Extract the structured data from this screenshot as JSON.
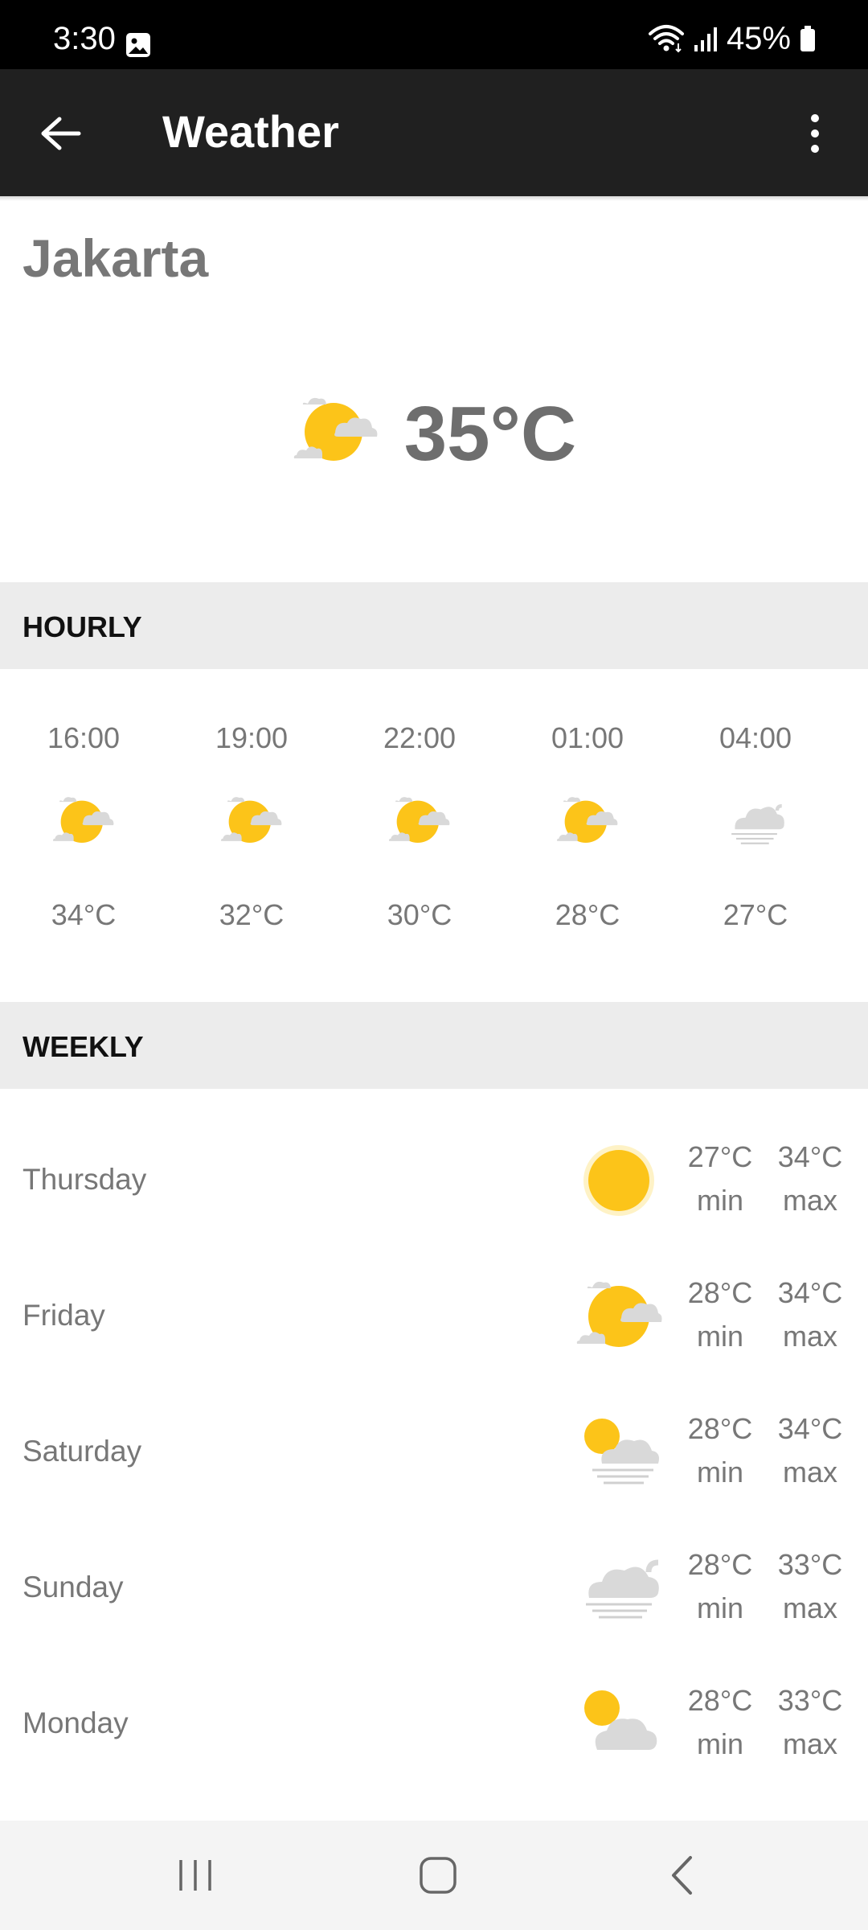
{
  "status_bar": {
    "time": "3:30",
    "battery": "45%"
  },
  "app_bar": {
    "title": "Weather"
  },
  "current": {
    "city": "Jakarta",
    "temperature": "35°C",
    "icon": "partly-cloudy-icon"
  },
  "hourly": {
    "header": "HOURLY",
    "items": [
      {
        "time": "16:00",
        "temp": "34°C",
        "icon": "partly-cloudy-icon"
      },
      {
        "time": "19:00",
        "temp": "32°C",
        "icon": "partly-cloudy-icon"
      },
      {
        "time": "22:00",
        "temp": "30°C",
        "icon": "partly-cloudy-icon"
      },
      {
        "time": "01:00",
        "temp": "28°C",
        "icon": "partly-cloudy-icon"
      },
      {
        "time": "04:00",
        "temp": "27°C",
        "icon": "fog-icon"
      }
    ]
  },
  "weekly": {
    "header": "WEEKLY",
    "min_label": "min",
    "max_label": "max",
    "days": [
      {
        "name": "Thursday",
        "min": "27°C",
        "max": "34°C",
        "icon": "sunny-icon"
      },
      {
        "name": "Friday",
        "min": "28°C",
        "max": "34°C",
        "icon": "partly-cloudy-icon"
      },
      {
        "name": "Saturday",
        "min": "28°C",
        "max": "34°C",
        "icon": "sun-haze-icon"
      },
      {
        "name": "Sunday",
        "min": "28°C",
        "max": "33°C",
        "icon": "cloud-haze-icon"
      },
      {
        "name": "Monday",
        "min": "28°C",
        "max": "33°C",
        "icon": "sun-behind-cloud-icon"
      }
    ]
  },
  "colors": {
    "sun": "#fcc419",
    "cloud": "#d9d9d9",
    "app_bar": "#202020",
    "header_bg": "#ececec"
  }
}
